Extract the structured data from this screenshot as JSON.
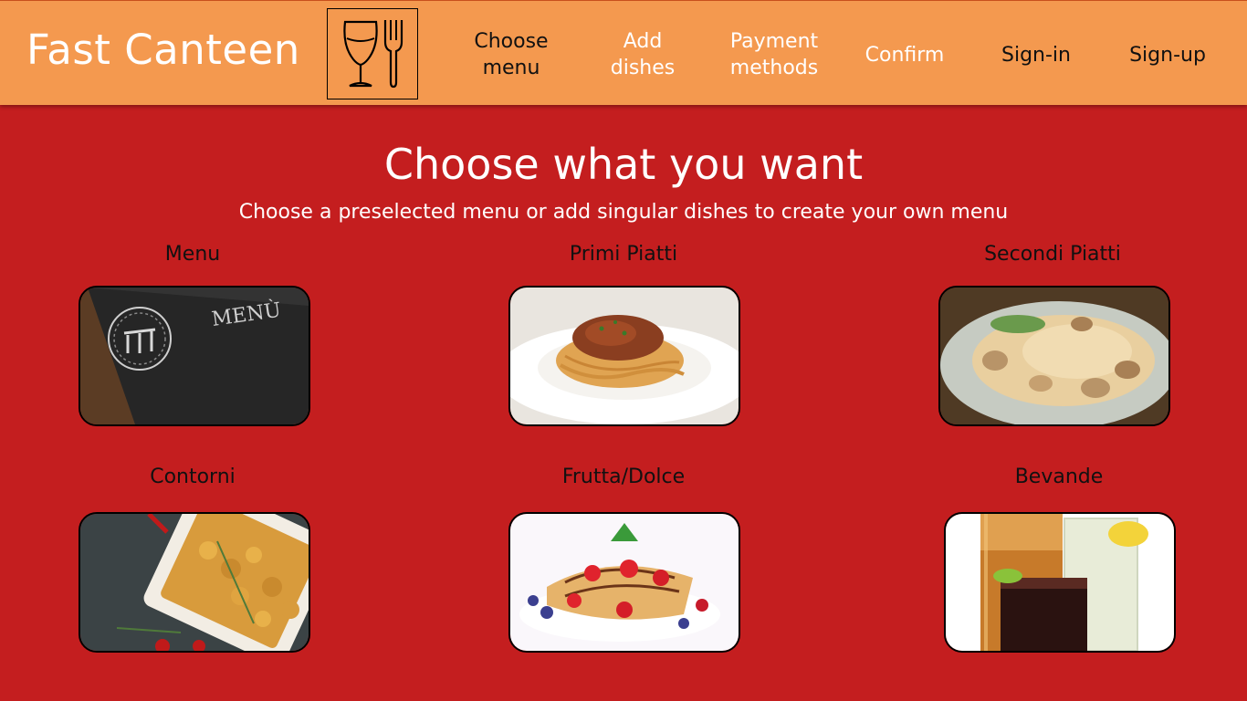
{
  "header": {
    "brand": "Fast Canteen",
    "logo_icon": "wine-glass-fork-icon",
    "nav": [
      {
        "line1": "Choose",
        "line2": "menu"
      },
      {
        "line1": "Add",
        "line2": "dishes"
      },
      {
        "line1": "Payment",
        "line2": "methods"
      },
      {
        "line1": "Confirm",
        "line2": ""
      },
      {
        "line1": "Sign-in",
        "line2": ""
      },
      {
        "line1": "Sign-up",
        "line2": ""
      }
    ]
  },
  "main": {
    "title": "Choose what you want",
    "subtitle": "Choose a preselected menu or add singular dishes to create your own menu",
    "categories": [
      {
        "label": "Menu"
      },
      {
        "label": "Primi Piatti"
      },
      {
        "label": "Secondi Piatti"
      },
      {
        "label": "Contorni"
      },
      {
        "label": "Frutta/Dolce"
      },
      {
        "label": "Bevande"
      }
    ],
    "menu_card_text": "MENÙ"
  },
  "colors": {
    "header_bg": "#f4994f",
    "page_bg": "#c41e1f",
    "text_light": "#ffffff",
    "text_dark": "#111111"
  }
}
